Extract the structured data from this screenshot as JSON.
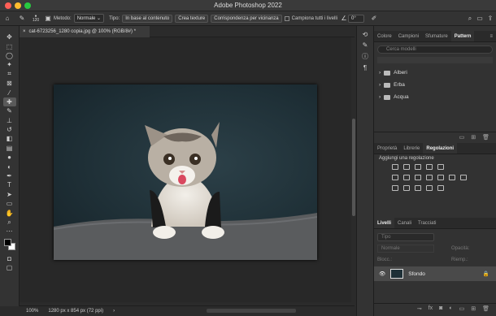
{
  "window": {
    "title": "Adobe Photoshop 2022"
  },
  "options_bar": {
    "brush_size": "120",
    "mode_label": "Metodo:",
    "mode_value": "Normale",
    "type_label": "Tipo:",
    "type_options": [
      "In base al contenuto",
      "Crea texture",
      "Corrispondenza per vicinanza"
    ],
    "sample_all_layers": "Campiona tutti i livelli",
    "angle_value": "0°"
  },
  "document": {
    "tab_title": "cat-6723256_1280 copia.jpg @ 100% (RGB/8#) *",
    "zoom": "100%",
    "info": "1280 px x 854 px (72 ppi)"
  },
  "pattern_panel": {
    "tabs": [
      "Colore",
      "Campioni",
      "Sfumature",
      "Pattern"
    ],
    "active_tab": "Pattern",
    "search_placeholder": "Cerca modelli",
    "folders": [
      "Alberi",
      "Erba",
      "Acqua"
    ]
  },
  "adjust_panel": {
    "tabs": [
      "Proprietà",
      "Librerie",
      "Regolazioni"
    ],
    "active_tab": "Regolazioni",
    "heading": "Aggiungi una regolazione"
  },
  "layers_panel": {
    "tabs": [
      "Livelli",
      "Canali",
      "Tracciati"
    ],
    "active_tab": "Livelli",
    "kind_placeholder": "Tipo",
    "blend_mode": "Normale",
    "opacity_label": "Opacità:",
    "lock_label": "Blocc.:",
    "fill_label": "Riemp.:",
    "layer_name": "Sfondo"
  },
  "colors": {
    "accent": "#e9a235",
    "bg": "#2b2b2b",
    "panel": "#323232"
  }
}
